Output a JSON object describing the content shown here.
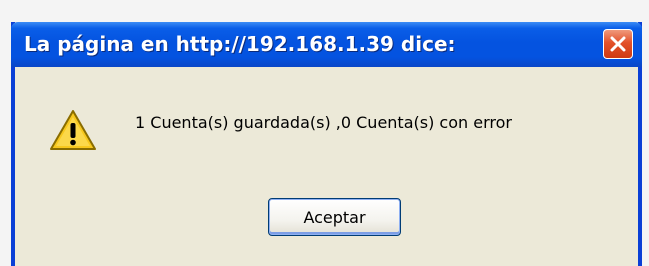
{
  "dialog": {
    "title": "La página en http://192.168.1.39 dice:",
    "message": "1 Cuenta(s) guardada(s) ,0 Cuenta(s) con error",
    "accept_label": "Aceptar",
    "icon": "warning-icon",
    "close_icon": "close-icon"
  },
  "colors": {
    "titlebar": "#0453e0",
    "close_button": "#e3512a",
    "dialog_background": "#ece9d8",
    "warning_yellow": "#f7c81e"
  }
}
